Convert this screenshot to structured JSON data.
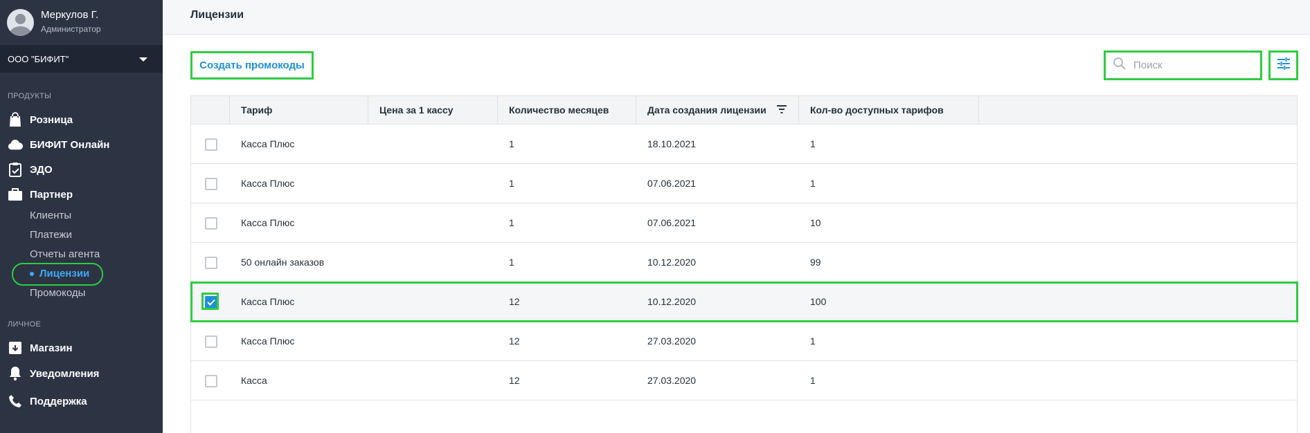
{
  "user": {
    "name": "Меркулов Г.",
    "role": "Администратор"
  },
  "org": {
    "name": "ООО \"БИФИТ\""
  },
  "sidebar": {
    "products_label": "ПРОДУКТЫ",
    "personal_label": "ЛИЧНОЕ",
    "items": [
      {
        "label": "Розница",
        "icon": "shopping-bag-icon"
      },
      {
        "label": "БИФИТ Онлайн",
        "icon": "cloud-icon"
      },
      {
        "label": "ЭДО",
        "icon": "clipboard-check-icon"
      },
      {
        "label": "Партнер",
        "icon": "briefcase-icon"
      }
    ],
    "partner_sub": [
      {
        "label": "Клиенты"
      },
      {
        "label": "Платежи"
      },
      {
        "label": "Отчеты агента"
      },
      {
        "label": "Лицензии",
        "active": true
      },
      {
        "label": "Промокоды"
      }
    ],
    "personal_items": [
      {
        "label": "Магазин",
        "icon": "store-icon"
      },
      {
        "label": "Уведомления",
        "icon": "bell-icon"
      },
      {
        "label": "Поддержка",
        "icon": "phone-icon"
      }
    ]
  },
  "header": {
    "title": "Лицензии"
  },
  "toolbar": {
    "create_label": "Создать промокоды",
    "search_placeholder": "Поиск",
    "filter_icon": "sliders-icon"
  },
  "table": {
    "columns": [
      "Тариф",
      "Цена за 1 кассу",
      "Количество месяцев",
      "Дата создания лицензии",
      "Кол-во доступных тарифов"
    ],
    "rows": [
      {
        "tariff": "Касса Плюс",
        "price": "",
        "months": "1",
        "date": "18.10.2021",
        "available": "1",
        "checked": false
      },
      {
        "tariff": "Касса Плюс",
        "price": "",
        "months": "1",
        "date": "07.06.2021",
        "available": "1",
        "checked": false
      },
      {
        "tariff": "Касса Плюс",
        "price": "",
        "months": "1",
        "date": "07.06.2021",
        "available": "10",
        "checked": false
      },
      {
        "tariff": "50 онлайн заказов",
        "price": "",
        "months": "1",
        "date": "10.12.2020",
        "available": "99",
        "checked": false
      },
      {
        "tariff": "Касса Плюс",
        "price": "",
        "months": "12",
        "date": "10.12.2020",
        "available": "100",
        "checked": true
      },
      {
        "tariff": "Касса Плюс",
        "price": "",
        "months": "12",
        "date": "27.03.2020",
        "available": "1",
        "checked": false
      },
      {
        "tariff": "Касса",
        "price": "",
        "months": "12",
        "date": "27.03.2020",
        "available": "1",
        "checked": false
      }
    ]
  },
  "colors": {
    "accent": "#1e90d6",
    "highlight": "#2ecc40",
    "sidebar_bg": "#2c3444",
    "active_link": "#3fa9f5"
  }
}
